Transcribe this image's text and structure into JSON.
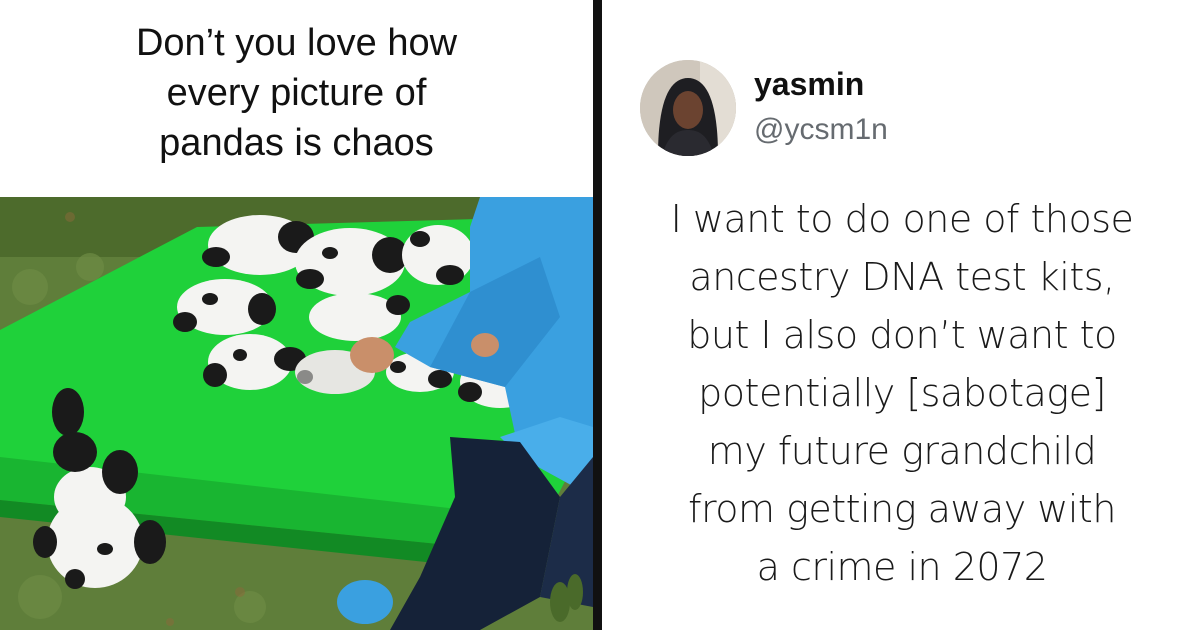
{
  "meme": {
    "caption": "Don’t you love how\nevery picture of\npandas is chaos"
  },
  "tweet": {
    "display_name": "yasmin",
    "handle": "@ycsm1n",
    "text": "I want to do one of those\nancestry DNA test kits,\nbut I also don’t want to\npotentially [sabotage]\nmy future grandchild\nfrom getting away with\na crime in 2072"
  },
  "colors": {
    "divider": "#111111",
    "table_green": "#1fd13a",
    "grass": "#5a7a35",
    "raincoat_blue": "#3aa0e0",
    "handle_gray": "#666b70"
  }
}
